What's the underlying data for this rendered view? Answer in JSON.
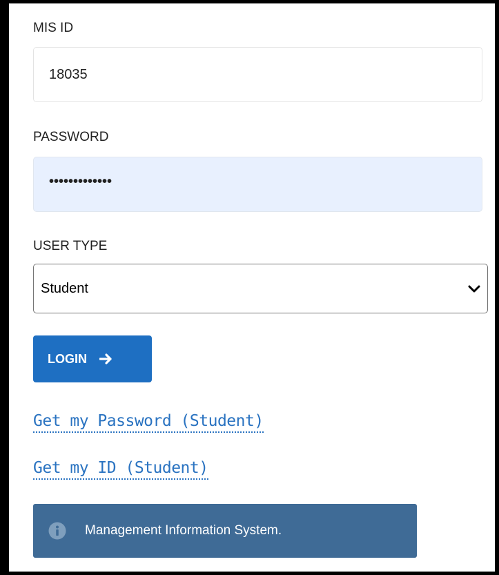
{
  "form": {
    "mis_id_label": "MIS ID",
    "mis_id_value": "18035",
    "password_label": "PASSWORD",
    "password_mask": "•••••••••••••",
    "user_type_label": "USER TYPE",
    "user_type_selected": "Student",
    "login_label": "LOGIN"
  },
  "links": {
    "get_password": "Get my Password (Student)",
    "get_id": "Get my ID (Student)"
  },
  "info": {
    "message": "Management Information System."
  },
  "icons": {
    "login": "arrow-right-icon",
    "select": "chevron-down-icon",
    "info": "info-circle-icon"
  },
  "colors": {
    "primary_button": "#1e6fc2",
    "link": "#2a73c1",
    "info_panel": "#3f6b96",
    "autofill_bg": "#e8f0fe"
  }
}
